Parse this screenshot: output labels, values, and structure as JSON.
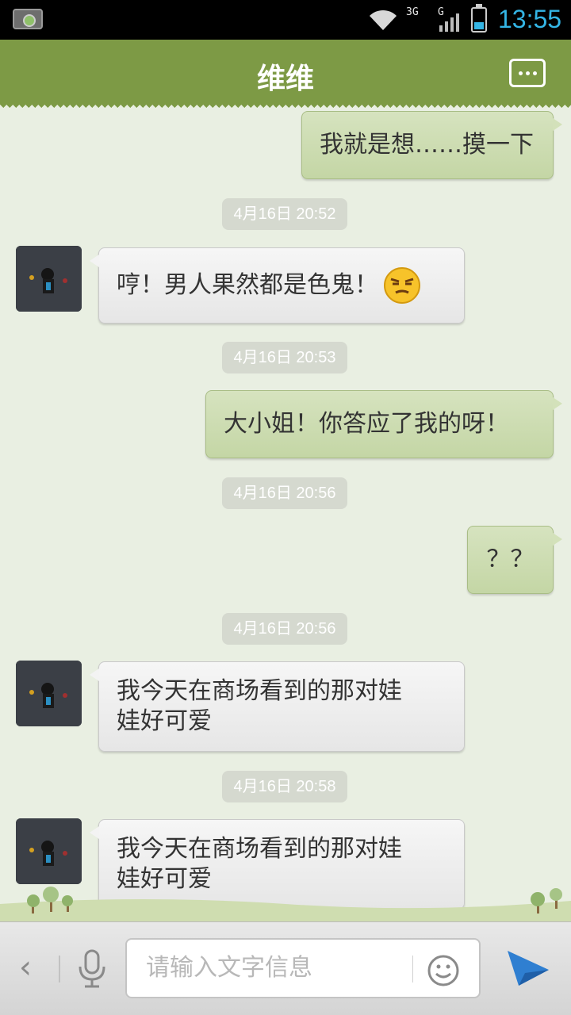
{
  "status_bar": {
    "network_label": "3G",
    "network_label2": "G",
    "time": "13:55",
    "icons": [
      "camera-icon",
      "wifi-icon",
      "signal-icon",
      "battery-icon"
    ]
  },
  "header": {
    "title": "维维",
    "more_icon": "more-dots-icon"
  },
  "messages": [
    {
      "side": "right",
      "text": "我就是想……摸一下"
    },
    {
      "timestamp": "4月16日 20:52"
    },
    {
      "side": "left",
      "text": "哼！男人果然都是色鬼！",
      "emoji": "smirk-emoji-icon"
    },
    {
      "timestamp": "4月16日 20:53"
    },
    {
      "side": "right",
      "text": "大小姐！你答应了我的呀！"
    },
    {
      "timestamp": "4月16日 20:56"
    },
    {
      "side": "right",
      "text": "？？"
    },
    {
      "timestamp": "4月16日 20:56"
    },
    {
      "side": "left",
      "text_line1": "我今天在商场看到的那对娃",
      "text_line2": "娃好可爱"
    },
    {
      "timestamp": "4月16日 20:58"
    },
    {
      "side": "left",
      "text_line1": "我今天在商场看到的那对娃",
      "text_line2": "娃好可爱"
    }
  ],
  "input_bar": {
    "placeholder": "请输入文字信息",
    "icons": [
      "back-chevron-icon",
      "microphone-icon",
      "smiley-icon",
      "send-icon"
    ]
  },
  "colors": {
    "header": "#7d9a45",
    "background": "#e9efe2",
    "clock": "#34b5e5",
    "right_bubble": "#cfddb5",
    "left_bubble": "#eeeeee",
    "timestamp_bg": "#d5d9cf"
  }
}
